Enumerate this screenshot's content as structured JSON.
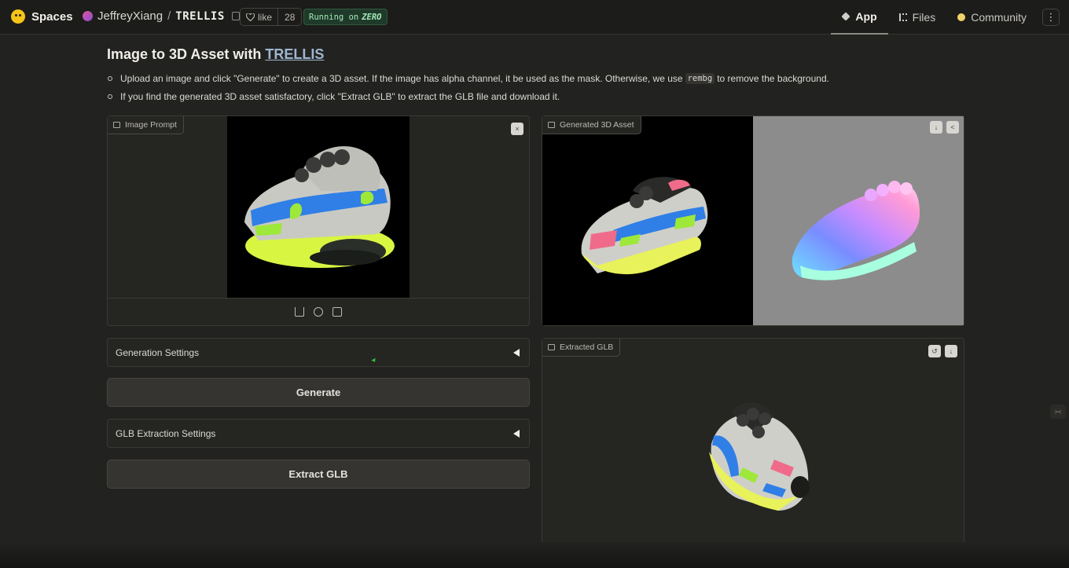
{
  "topbar": {
    "brand": "Spaces",
    "repo_owner": "JeffreyXiang",
    "repo_slash": "/",
    "repo_name": "TRELLIS",
    "like_label": "like",
    "like_count": "28",
    "running_prefix": "Running on",
    "running_hw": "ZERO",
    "tabs": [
      {
        "label": "App",
        "icon": "cube-icon"
      },
      {
        "label": "Files",
        "icon": "files-icon"
      },
      {
        "label": "Community",
        "icon": "community-icon"
      }
    ],
    "menu_glyph": "⋮"
  },
  "header": {
    "title_prefix": "Image to 3D Asset with ",
    "title_link": "TRELLIS",
    "bullet1_a": "Upload an image and click \"Generate\" to create a 3D asset. If the image has alpha channel, it be used as the mask. Otherwise, we use",
    "bullet1_code": "rembg",
    "bullet1_b": "to remove the background.",
    "bullet2": "If you find the generated 3D asset satisfactory, click \"Extract GLB\" to extract the GLB file and download it."
  },
  "image_prompt": {
    "label": "Image Prompt",
    "close_glyph": "×"
  },
  "generated": {
    "label": "Generated 3D Asset",
    "download_glyph": "↓",
    "share_glyph": "<"
  },
  "extracted": {
    "label": "Extracted GLB",
    "reset_glyph": "↺",
    "download_glyph": "↓"
  },
  "controls": {
    "generation_settings": "Generation Settings",
    "generate_button": "Generate",
    "glb_settings": "GLB Extraction Settings",
    "extract_button": "Extract GLB"
  },
  "side_handle": "><",
  "colors": {
    "accent_link": "#9fb6cf",
    "running_bg": "#1f3a2a",
    "running_text": "#a4e7b8",
    "bg": "#222220"
  }
}
